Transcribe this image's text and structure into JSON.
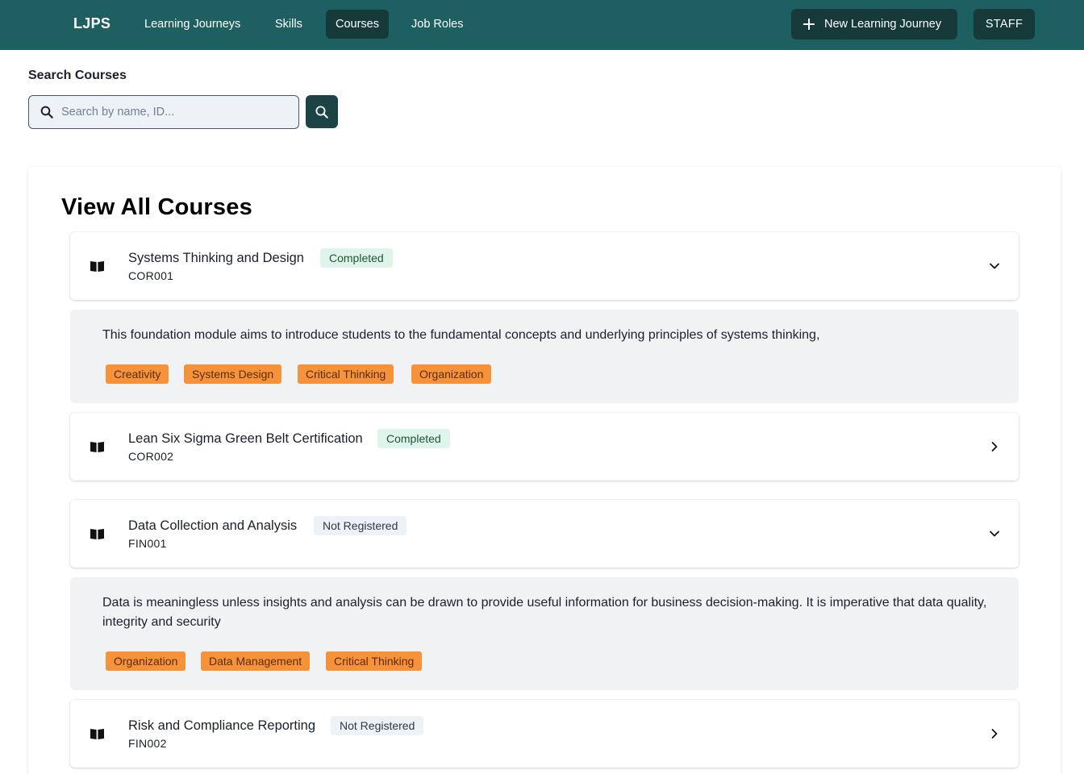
{
  "nav": {
    "brand": "LJPS",
    "links": [
      "Learning Journeys",
      "Skills",
      "Courses",
      "Job Roles"
    ],
    "active": "Courses",
    "new_journey_label": "New Learning Journey",
    "staff_label": "STAFF",
    "icons": {
      "new": "plus-icon"
    }
  },
  "search": {
    "label": "Search Courses",
    "placeholder": "Search by name, ID...",
    "value": "",
    "icons": {
      "field": "search-icon",
      "button": "search-icon"
    }
  },
  "main": {
    "title": "View All Courses",
    "courses": [
      {
        "name": "Systems Thinking and Design",
        "id": "COR001",
        "status": "Completed",
        "expanded": true,
        "description": "This foundation module aims to introduce students to the fundamental concepts and underlying principles of systems thinking,",
        "skills": [
          "Creativity",
          "Systems Design",
          "Critical Thinking",
          "Organization"
        ]
      },
      {
        "name": "Lean Six Sigma Green Belt Certification",
        "id": "COR002",
        "status": "Completed",
        "expanded": false
      },
      {
        "name": "Data Collection and Analysis",
        "id": "FIN001",
        "status": "Not Registered",
        "expanded": true,
        "description": "Data is meaningless unless insights and analysis can be drawn to provide useful information for business decision-making. It is imperative that data quality, integrity and security",
        "skills": [
          "Organization",
          "Data Management",
          "Critical Thinking"
        ]
      },
      {
        "name": "Risk and Compliance Reporting",
        "id": "FIN002",
        "status": "Not Registered",
        "expanded": false
      }
    ],
    "icons": {
      "course": "book-icon",
      "expanded": "chevron-down-icon",
      "collapsed": "chevron-right-icon"
    }
  },
  "colors": {
    "nav_bg": "#1e5f62",
    "nav_active": "#16393a",
    "completed_bg": "#dff5ea",
    "not_registered_bg": "#edf2f7",
    "skill_tag": "#f6923a"
  }
}
